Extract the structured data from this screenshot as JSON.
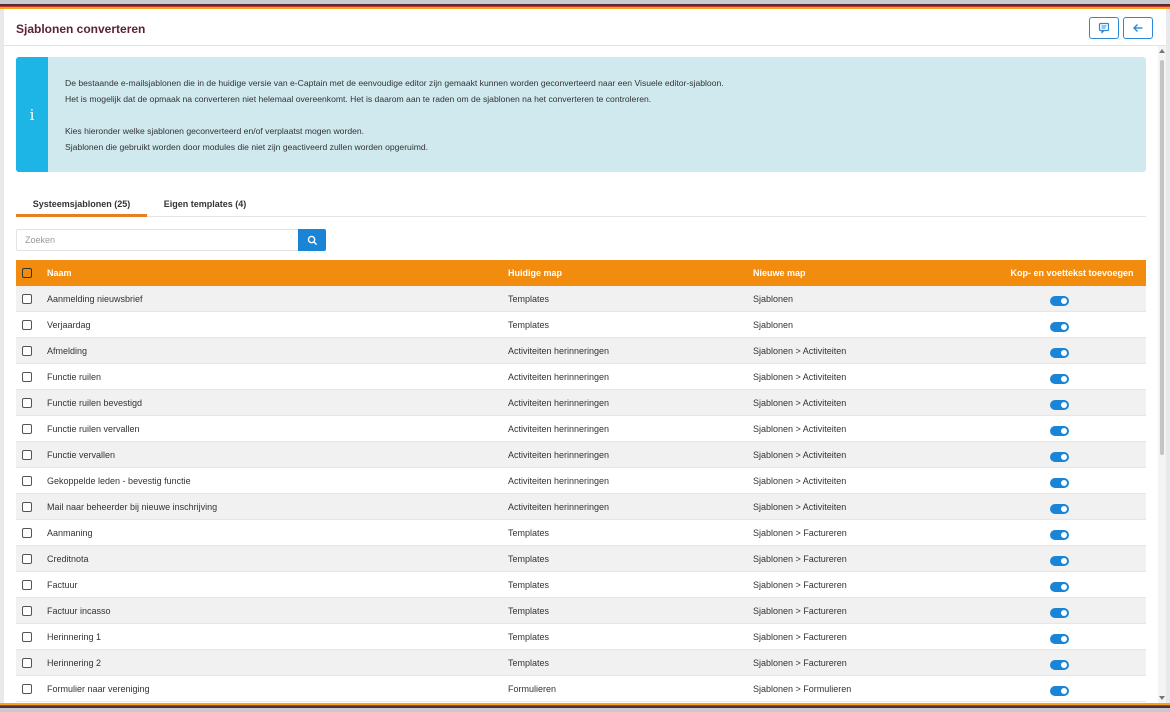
{
  "header": {
    "title": "Sjablonen converteren",
    "feedback_icon": "chat-icon",
    "back_icon": "arrow-left-icon"
  },
  "info": {
    "icon": "info-icon",
    "icon_glyph": "i",
    "lines": [
      "De bestaande e-mailsjablonen die in de huidige versie van e-Captain met de eenvoudige editor zijn gemaakt kunnen worden geconverteerd naar een Visuele editor-sjabloon.",
      "Het is mogelijk dat de opmaak na converteren niet helemaal overeenkomt. Het is daarom aan te raden om de sjablonen na het converteren te controleren.",
      "Kies hieronder welke sjablonen geconverteerd en/of verplaatst mogen worden.",
      "Sjablonen die gebruikt worden door modules die niet zijn geactiveerd zullen worden opgeruimd."
    ]
  },
  "tabs": [
    {
      "label": "Systeemsjablonen (25)",
      "active": true
    },
    {
      "label": "Eigen templates (4)",
      "active": false
    }
  ],
  "search": {
    "placeholder": "Zoeken",
    "value": "",
    "button_icon": "search-icon"
  },
  "table": {
    "columns": [
      "Naam",
      "Huidige map",
      "Nieuwe map",
      "Kop- en voettekst toevoegen"
    ],
    "rows": [
      {
        "name": "Aanmelding nieuwsbrief",
        "current": "Templates",
        "new": "Sjablonen",
        "toggle": true
      },
      {
        "name": "Verjaardag",
        "current": "Templates",
        "new": "Sjablonen",
        "toggle": true
      },
      {
        "name": "Afmelding",
        "current": "Activiteiten herinneringen",
        "new": "Sjablonen > Activiteiten",
        "toggle": true
      },
      {
        "name": "Functie ruilen",
        "current": "Activiteiten herinneringen",
        "new": "Sjablonen > Activiteiten",
        "toggle": true
      },
      {
        "name": "Functie ruilen bevestigd",
        "current": "Activiteiten herinneringen",
        "new": "Sjablonen > Activiteiten",
        "toggle": true
      },
      {
        "name": "Functie ruilen vervallen",
        "current": "Activiteiten herinneringen",
        "new": "Sjablonen > Activiteiten",
        "toggle": true
      },
      {
        "name": "Functie vervallen",
        "current": "Activiteiten herinneringen",
        "new": "Sjablonen > Activiteiten",
        "toggle": true
      },
      {
        "name": "Gekoppelde leden - bevestig functie",
        "current": "Activiteiten herinneringen",
        "new": "Sjablonen > Activiteiten",
        "toggle": true
      },
      {
        "name": "Mail naar beheerder bij nieuwe inschrijving",
        "current": "Activiteiten herinneringen",
        "new": "Sjablonen > Activiteiten",
        "toggle": true
      },
      {
        "name": "Aanmaning",
        "current": "Templates",
        "new": "Sjablonen > Factureren",
        "toggle": true
      },
      {
        "name": "Creditnota",
        "current": "Templates",
        "new": "Sjablonen > Factureren",
        "toggle": true
      },
      {
        "name": "Factuur",
        "current": "Templates",
        "new": "Sjablonen > Factureren",
        "toggle": true
      },
      {
        "name": "Factuur incasso",
        "current": "Templates",
        "new": "Sjablonen > Factureren",
        "toggle": true
      },
      {
        "name": "Herinnering 1",
        "current": "Templates",
        "new": "Sjablonen > Factureren",
        "toggle": true
      },
      {
        "name": "Herinnering 2",
        "current": "Templates",
        "new": "Sjablonen > Factureren",
        "toggle": true
      },
      {
        "name": "Formulier naar vereniging",
        "current": "Formulieren",
        "new": "Sjablonen > Formulieren",
        "toggle": true
      }
    ]
  },
  "colors": {
    "accent_orange": "#f28c0f",
    "primary_blue": "#1a84d6",
    "info_bg": "#cfe9ef",
    "info_bar": "#1db4e6",
    "title_color": "#5a2336"
  }
}
